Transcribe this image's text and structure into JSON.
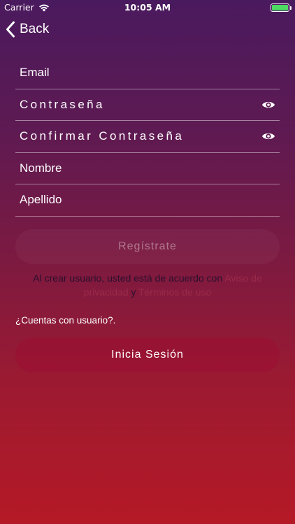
{
  "status_bar": {
    "carrier": "Carrier",
    "time": "10:05 AM",
    "battery_color": "#4cd964"
  },
  "nav": {
    "back_label": "Back"
  },
  "form": {
    "email_placeholder": "Email",
    "password_placeholder": "Contraseña",
    "confirm_password_placeholder": "Confirmar Contraseña",
    "first_name_placeholder": "Nombre",
    "last_name_placeholder": "Apellido"
  },
  "register_button": {
    "label": "Regístrate"
  },
  "terms": {
    "prefix": "Al crear usuario, usted está de acuerdo con ",
    "privacy_link": "Aviso de privacidad",
    "conjunction": " y ",
    "terms_link": "Términos de uso"
  },
  "has_account": {
    "text": "¿Cuentas con usuario?."
  },
  "login_button": {
    "label": "Inicia Sesión"
  },
  "colors": {
    "gradient_top": "#4a1a5e",
    "gradient_bottom": "#b51926",
    "link": "#9a2a4a"
  }
}
